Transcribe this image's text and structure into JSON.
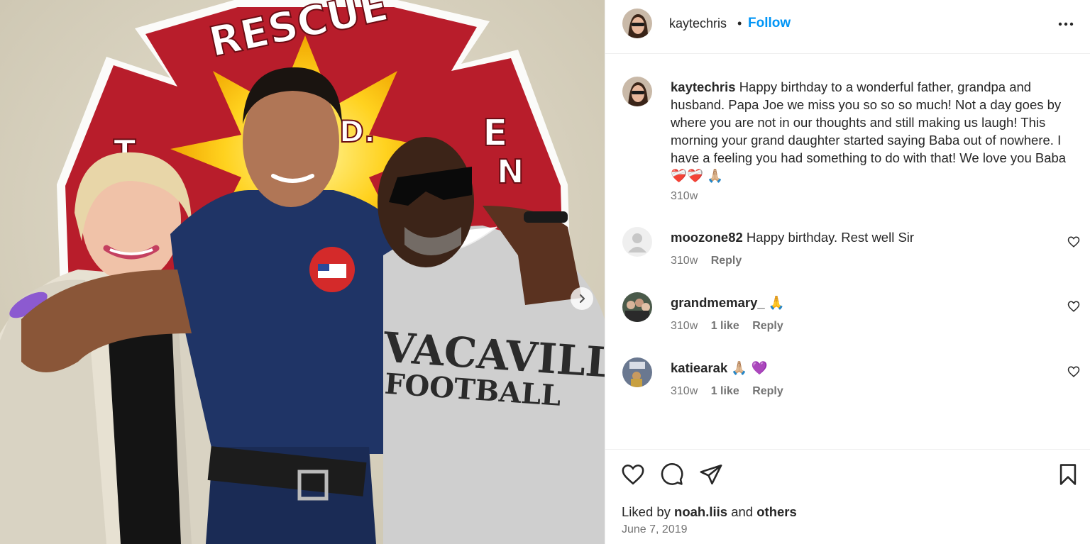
{
  "header": {
    "username": "kaytechris",
    "separator": "•",
    "follow_label": "Follow",
    "more_icon": "more-options-icon"
  },
  "caption": {
    "username": "kaytechris",
    "text": "Happy birthday to a wonderful father, grandpa and husband. Papa Joe we miss you so so so much! Not a day goes by where you are not in our thoughts and still making us laugh! This morning your grand daughter started saying Baba out of nowhere. I have a feeling you had something to do with that! We love you Baba ❤️‍🩹❤️‍🩹 🙏🏼",
    "time": "310w"
  },
  "comments": [
    {
      "username": "moozone82",
      "text": "Happy birthday. Rest well Sir",
      "time": "310w",
      "likes": "",
      "reply_label": "Reply"
    },
    {
      "username": "grandmemary_",
      "text": "🙏",
      "time": "310w",
      "likes": "1 like",
      "reply_label": "Reply"
    },
    {
      "username": "katiearak",
      "text": "🙏🏼 💜",
      "time": "310w",
      "likes": "1 like",
      "reply_label": "Reply"
    }
  ],
  "actions": {
    "like_icon": "heart-icon",
    "comment_icon": "comment-icon",
    "share_icon": "send-icon",
    "save_icon": "bookmark-icon"
  },
  "liked_by": {
    "prefix": "Liked by",
    "user": "noah.liis",
    "conj": "and",
    "others": "others"
  },
  "date": "June 7, 2019",
  "photo": {
    "badge_top_text": "RESCUE",
    "shirt_text_line1": "VACAVILLE",
    "shirt_text_line2": "FOOTBALL",
    "next_icon": "chevron-right-icon"
  },
  "colors": {
    "accent": "#0095f6",
    "text": "#262626",
    "muted": "#737373"
  }
}
